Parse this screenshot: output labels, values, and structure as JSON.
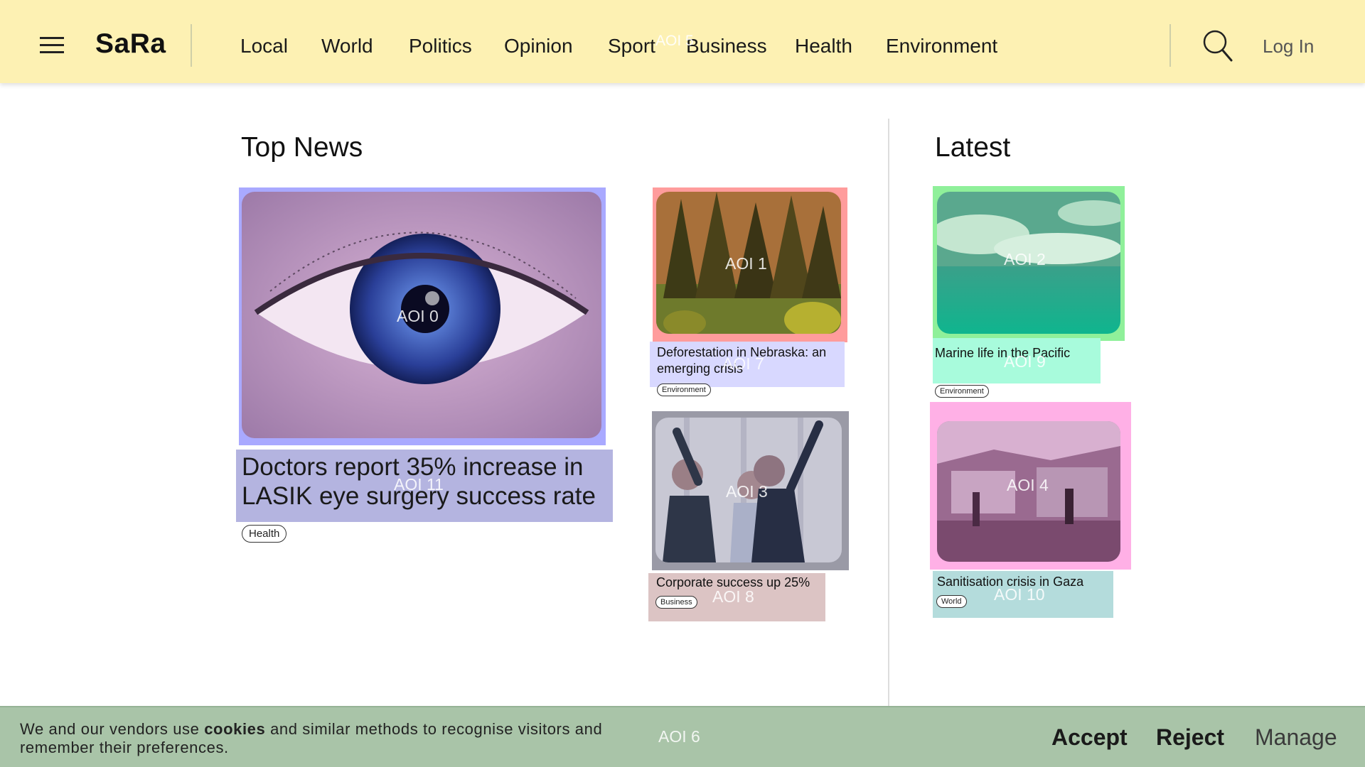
{
  "header": {
    "logo": "SaRa",
    "nav": [
      "Local",
      "World",
      "Politics",
      "Opinion",
      "Sport",
      "Business",
      "Health",
      "Environment"
    ],
    "login_label": "Log In",
    "overlay_label": "AOI 5"
  },
  "sections": {
    "top_news_title": "Top News",
    "latest_title": "Latest"
  },
  "main_story": {
    "headline": "Doctors report 35% increase in LASIK eye surgery success rate",
    "tag": "Health",
    "image_aoi": "AOI 0",
    "headline_aoi": "AOI 11"
  },
  "stories": [
    {
      "headline": "Deforestation in Nebraska: an emerging crisis",
      "tag": "Environment",
      "image_aoi": "AOI 1",
      "headline_aoi": "AOI 7"
    },
    {
      "headline": "Corporate success up 25%",
      "tag": "Business",
      "image_aoi": "AOI 3",
      "headline_aoi": "AOI 8"
    },
    {
      "headline": "Marine life in the Pacific",
      "tag": "Environment",
      "image_aoi": "AOI 2",
      "headline_aoi": "AOI 9"
    },
    {
      "headline": "Sanitisation crisis in Gaza",
      "tag": "World",
      "image_aoi": "AOI 4",
      "headline_aoi": "AOI 10"
    }
  ],
  "cookie_bar": {
    "text_before": "We and our vendors use ",
    "text_bold": "cookies",
    "text_after": " and similar methods to recognise visitors and remember their preferences.",
    "accept_label": "Accept",
    "reject_label": "Reject",
    "manage_label": "Manage",
    "overlay_label": "AOI 6"
  },
  "icons": {
    "menu": "hamburger-menu-icon",
    "search": "search-icon"
  },
  "colors": {
    "header_bg": "#fdf1b3",
    "cookie_bg": "#a9c4a8",
    "aoi0": "#a9a9ff",
    "aoi1": "#ff9c9c",
    "aoi2": "#8ff09a",
    "aoi3": "#9a9aa6",
    "aoi4": "#ffb0e6",
    "aoi7": "#d8d8ff",
    "aoi8": "#dcc4c4",
    "aoi9": "#a8fbdc",
    "aoi10": "#b4dcdc",
    "aoi11": "#b4b4e0"
  }
}
